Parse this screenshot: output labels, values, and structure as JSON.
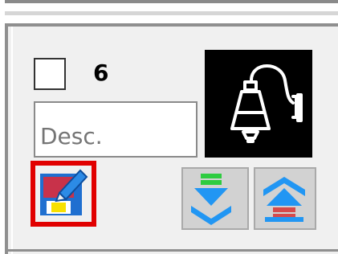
{
  "item": {
    "checkbox_checked": false,
    "count": "6",
    "description_placeholder": "Desc.",
    "description_value": ""
  },
  "icons": {
    "bell": "bell-icon",
    "save": "save-icon",
    "move_down": "move-down-icon",
    "move_up": "move-up-icon"
  },
  "colors": {
    "selection_outline": "#e10000",
    "tile_background": "#000000",
    "move_down_bar": "#2ecc40",
    "move_up_bar": "#d64a4a",
    "arrow_blue": "#2196f3"
  }
}
